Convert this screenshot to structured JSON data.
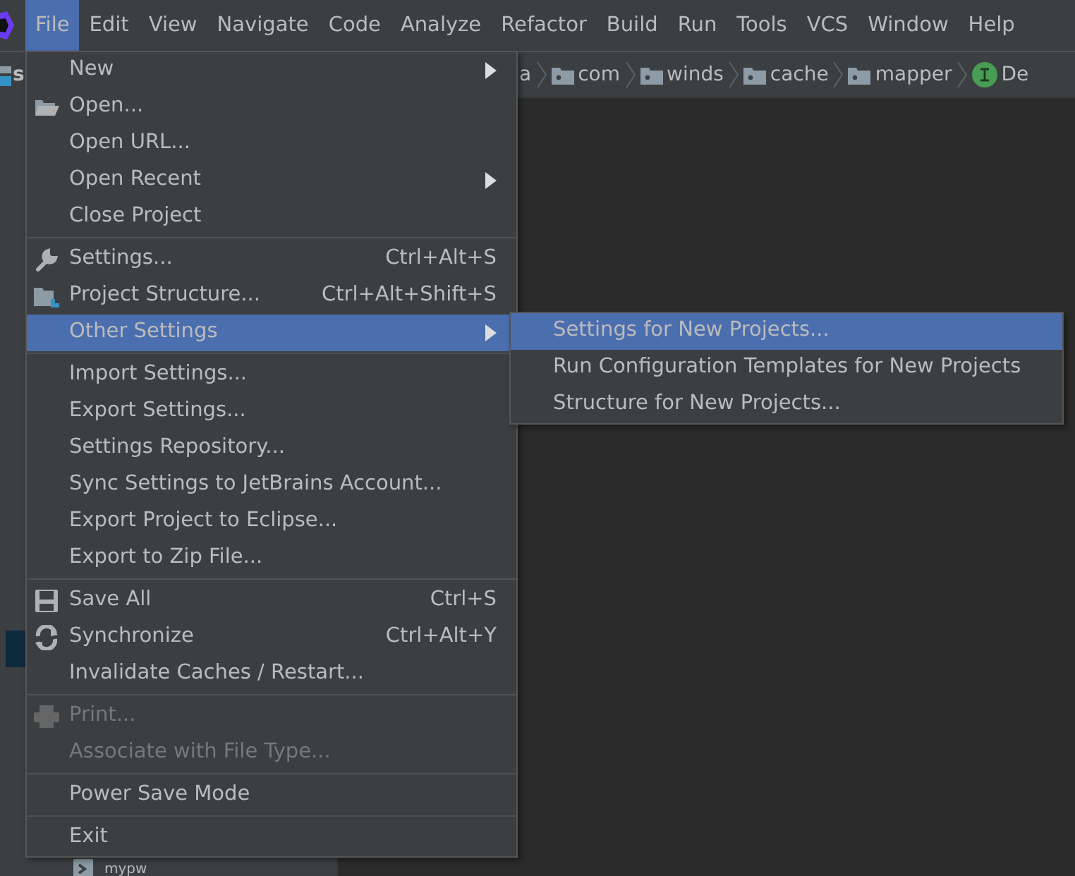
{
  "menubar": [
    {
      "label": "File",
      "selected": true
    },
    {
      "label": "Edit",
      "selected": false
    },
    {
      "label": "View",
      "selected": false
    },
    {
      "label": "Navigate",
      "selected": false
    },
    {
      "label": "Code",
      "selected": false
    },
    {
      "label": "Analyze",
      "selected": false
    },
    {
      "label": "Refactor",
      "selected": false
    },
    {
      "label": "Build",
      "selected": false
    },
    {
      "label": "Run",
      "selected": false
    },
    {
      "label": "Tools",
      "selected": false
    },
    {
      "label": "VCS",
      "selected": false
    },
    {
      "label": "Window",
      "selected": false
    },
    {
      "label": "Help",
      "selected": false
    }
  ],
  "project_panel": {
    "title": "s",
    "tree_item": "mypw"
  },
  "breadcrumbs": [
    "a",
    "com",
    "winds",
    "cache",
    "mapper",
    "De"
  ],
  "file_menu": {
    "groups": [
      [
        {
          "label": "New",
          "submenu": true,
          "selected": false,
          "disabled": false
        },
        {
          "label": "Open...",
          "selected": false,
          "disabled": false
        },
        {
          "label": "Open URL...",
          "selected": false,
          "disabled": false
        },
        {
          "label": "Open Recent",
          "submenu": true,
          "selected": false,
          "disabled": false
        },
        {
          "label": "Close Project",
          "selected": false,
          "disabled": false
        }
      ],
      [
        {
          "label": "Settings...",
          "shortcut": "Ctrl+Alt+S",
          "selected": false,
          "disabled": false
        },
        {
          "label": "Project Structure...",
          "shortcut": "Ctrl+Alt+Shift+S",
          "selected": false,
          "disabled": false
        },
        {
          "label": "Other Settings",
          "submenu": true,
          "selected": true,
          "disabled": false
        }
      ],
      [
        {
          "label": "Import Settings...",
          "selected": false,
          "disabled": false
        },
        {
          "label": "Export Settings...",
          "selected": false,
          "disabled": false
        },
        {
          "label": "Settings Repository...",
          "selected": false,
          "disabled": false
        },
        {
          "label": "Sync Settings to JetBrains Account...",
          "selected": false,
          "disabled": false
        },
        {
          "label": "Export Project to Eclipse...",
          "selected": false,
          "disabled": false
        },
        {
          "label": "Export to Zip File...",
          "selected": false,
          "disabled": false
        }
      ],
      [
        {
          "label": "Save All",
          "shortcut": "Ctrl+S",
          "selected": false,
          "disabled": false
        },
        {
          "label": "Synchronize",
          "shortcut": "Ctrl+Alt+Y",
          "selected": false,
          "disabled": false
        },
        {
          "label": "Invalidate Caches / Restart...",
          "selected": false,
          "disabled": false
        }
      ],
      [
        {
          "label": "Print...",
          "selected": false,
          "disabled": true
        },
        {
          "label": "Associate with File Type...",
          "selected": false,
          "disabled": true
        }
      ],
      [
        {
          "label": "Power Save Mode",
          "selected": false,
          "disabled": false
        }
      ],
      [
        {
          "label": "Exit",
          "selected": false,
          "disabled": false
        }
      ]
    ]
  },
  "submenu": [
    {
      "label": "Settings for New Projects...",
      "selected": true
    },
    {
      "label": "Run Configuration Templates for New Projects",
      "selected": false
    },
    {
      "label": "Structure for New Projects...",
      "selected": false
    }
  ]
}
